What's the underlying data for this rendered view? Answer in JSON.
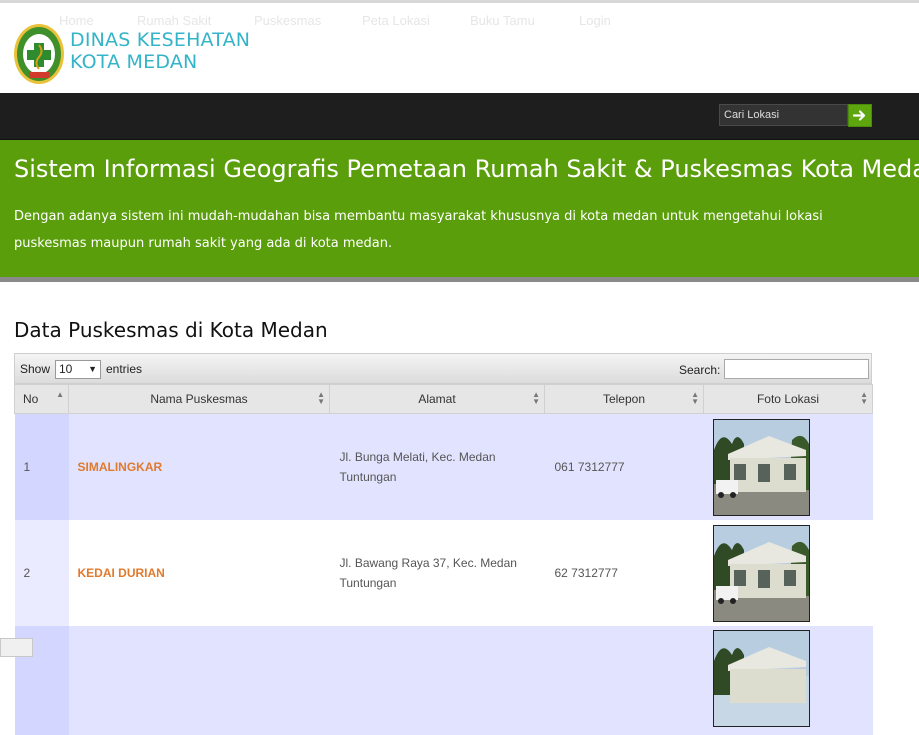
{
  "brand": {
    "line1": "DINAS KESEHATAN",
    "line2": "KOTA MEDAN",
    "seal_text": "DINAS KESEHATAN",
    "accent_color": "#33b4c8"
  },
  "nav": {
    "items": [
      "Home",
      "Rumah Sakit",
      "Puskesmas",
      "Peta Lokasi",
      "Buku Tamu",
      "Login"
    ],
    "search_placeholder": "Cari Lokasi"
  },
  "hero": {
    "title": "Sistem Informasi Geografis Pemetaan Rumah Sakit & Puskesmas Kota Medan",
    "text": "Dengan adanya sistem ini mudah-mudahan bisa membantu masyarakat khususnya di kota medan untuk mengetahui lokasi puskesmas maupun rumah sakit yang ada di kota medan.",
    "color": "#5a9e0b"
  },
  "section": {
    "title": "Data Puskesmas di Kota Medan"
  },
  "table": {
    "show_label": "Show",
    "entries_value": "10",
    "entries_label": "entries",
    "search_label": "Search:",
    "columns": [
      "No",
      "Nama Puskesmas",
      "Alamat",
      "Telepon",
      "Foto Lokasi"
    ],
    "rows": [
      {
        "no": "1",
        "name": "SIMALINGKAR",
        "address": "Jl. Bunga Melati, Kec. Medan Tuntungan",
        "phone": "061 7312777"
      },
      {
        "no": "2",
        "name": "KEDAI DURIAN",
        "address": "Jl. Bawang Raya 37, Kec. Medan Tuntungan",
        "phone": "62 7312777"
      },
      {
        "no": "",
        "name": "",
        "address": "",
        "phone": ""
      }
    ]
  }
}
